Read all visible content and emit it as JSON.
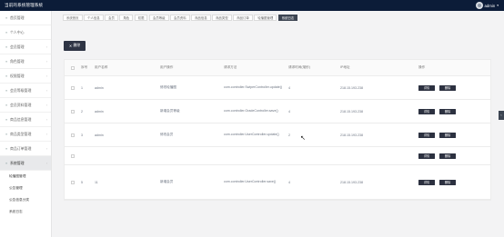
{
  "header": {
    "title": "当前的系统管理系统",
    "username": "admin",
    "caret": "▾"
  },
  "sidebar": {
    "items": [
      {
        "label": "首页管理"
      },
      {
        "label": "个人中心"
      },
      {
        "label": "会员管理"
      },
      {
        "label": "角色管理"
      },
      {
        "label": "权限管理"
      },
      {
        "label": "会员等级管理"
      },
      {
        "label": "会员资料管理"
      },
      {
        "label": "商品信息管理"
      },
      {
        "label": "商品类型管理"
      },
      {
        "label": "商品订单管理"
      },
      {
        "label": "系统管理"
      }
    ],
    "subitems": [
      {
        "label": "轮播图管理"
      },
      {
        "label": "公告管理"
      },
      {
        "label": "公告信息分类"
      },
      {
        "label": "系统日志"
      }
    ],
    "icon": "≡",
    "chevron": "›"
  },
  "tabs": [
    {
      "label": "系统首页"
    },
    {
      "label": "个人信息"
    },
    {
      "label": "会员"
    },
    {
      "label": "角色"
    },
    {
      "label": "权限"
    },
    {
      "label": "会员等级"
    },
    {
      "label": "会员资料"
    },
    {
      "label": "商品信息"
    },
    {
      "label": "商品类型"
    },
    {
      "label": "商品订单"
    },
    {
      "label": "轮播图管理"
    },
    {
      "label": "系统日志"
    }
  ],
  "toolbar": {
    "delete_icon": "✕",
    "delete_label": "删除"
  },
  "table": {
    "headers": {
      "seq": "序号",
      "user": "用户名称",
      "op": "用户操作",
      "method": "请求方法",
      "time": "请求时间(毫秒)",
      "ip": "IP地址",
      "action": "操作"
    },
    "rows": [
      {
        "seq": "1",
        "user": "admin",
        "op": "修改轮播图",
        "method": "com.controller.SwiperController.update()",
        "time": "4",
        "ip": "218.15.193.238",
        "detail": "详情",
        "delete": "删除"
      },
      {
        "seq": "2",
        "user": "admin",
        "op": "新增会员等级",
        "method": "com.controller.GradeController.save()",
        "time": "4",
        "ip": "218.15.193.238",
        "detail": "详情",
        "delete": "删除"
      },
      {
        "seq": "3",
        "user": "admin",
        "op": "修改会员",
        "method": "com.controller.UserController.update()",
        "time": "2",
        "ip": "218.15.193.238",
        "detail": "详情",
        "delete": "删除"
      },
      {
        "seq": "",
        "user": "",
        "op": "",
        "method": "",
        "time": "",
        "ip": "",
        "detail": "详情",
        "delete": "删除"
      },
      {
        "seq": "5",
        "user": "11",
        "op": "新增会员",
        "method": "com.controller.UserController.save()",
        "time": "4",
        "ip": "218.15.193.238",
        "detail": "详情",
        "delete": "删除"
      }
    ]
  },
  "colors": {
    "topbar": "#0c1c38",
    "button": "#2c3140",
    "active_tab": "#3d4552"
  }
}
